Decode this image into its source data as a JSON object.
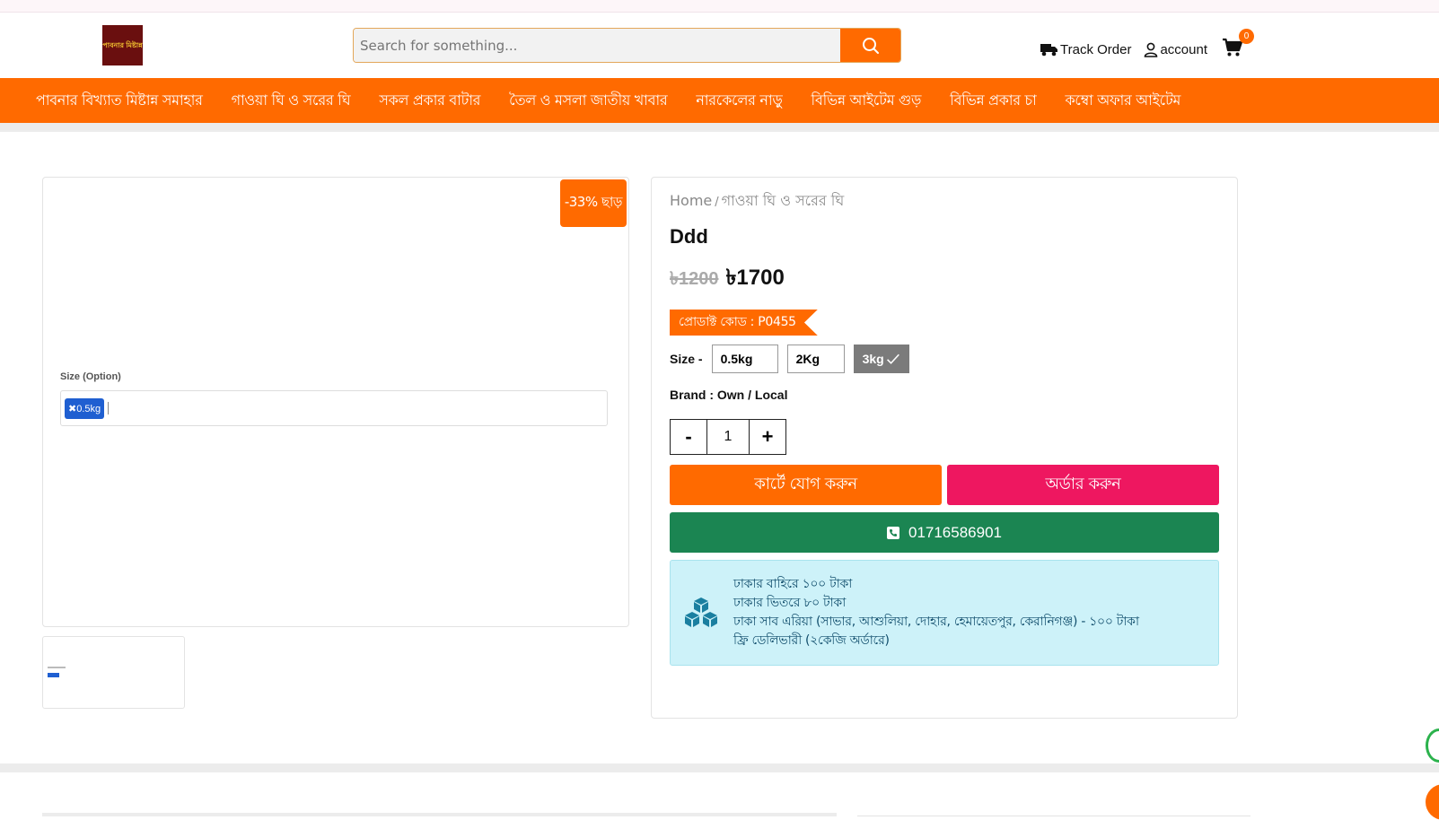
{
  "header": {
    "logo_text": "পাবনার মিষ্টান্ন",
    "search_placeholder": "Search for something...",
    "track_order": "Track Order",
    "account": "account",
    "cart_count": "0"
  },
  "nav": {
    "items": [
      "পাবনার বিখ্যাত মিষ্টান্ন সমাহার",
      "গাওয়া ঘি ও সরের ঘি",
      "সকল প্রকার বাটার",
      "তৈল ও মসলা জাতীয় খাবার",
      "নারকেলের নাড়ু",
      "বিভিন্ন আইটেম গুড়",
      "বিভিন্ন প্রকার চা",
      "কম্বো অফার আইটেম"
    ]
  },
  "gallery": {
    "discount": "-33% ছাড়",
    "size_label": "Size (Option)",
    "chip": "✖0.5kg"
  },
  "product": {
    "breadcrumb_home": "Home",
    "breadcrumb_sep": "/",
    "breadcrumb_cat": "গাওয়া ঘি ও সরের ঘি",
    "title": "Ddd",
    "old_price": "৳1200",
    "new_price": "৳1700",
    "code": "প্রোডাক্ট কোড : P0455",
    "size_label": "Size -",
    "sizes": [
      "0.5kg",
      "2Kg",
      "3kg"
    ],
    "brand": "Brand : Own / Local",
    "qty_minus": "-",
    "qty_value": "1",
    "qty_plus": "+",
    "add_to_cart": "কার্টে যোগ করুন",
    "order_now": "অর্ডার করুন",
    "phone": "01716586901",
    "delivery": [
      "ঢাকার বাহিরে ১০০ টাকা",
      "ঢাকার ভিতরে ৮০ টাকা",
      "ঢাকা সাব এরিয়া (সাভার, আশুলিয়া, দোহার, হেমায়েতপুর, কেরানিগঞ্জ) - ১০০ টাকা",
      "ফ্রি ডেলিভারী (২কেজি অর্ডারে)"
    ]
  },
  "colors": {
    "brand_orange": "#ff6a00",
    "order_pink": "#ee1760",
    "call_green": "#1b8552",
    "delivery_bg": "#cdf2f9"
  }
}
